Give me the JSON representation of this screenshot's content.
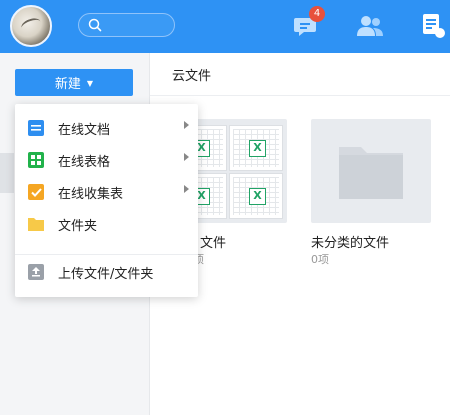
{
  "topbar": {
    "badge_count": "4",
    "accent_color": "#2e92f4",
    "icons": [
      "search-icon",
      "messages-icon",
      "contacts-icon",
      "docs-icon"
    ]
  },
  "sidebar": {
    "new_button_label": "新建"
  },
  "new_menu": {
    "items": [
      {
        "label": "在线文档",
        "icon": "online-doc-icon",
        "color": "#2e8ef0",
        "has_submenu": true
      },
      {
        "label": "在线表格",
        "icon": "online-sheet-icon",
        "color": "#21b24b",
        "has_submenu": true
      },
      {
        "label": "在线收集表",
        "icon": "online-form-icon",
        "color": "#f5a623",
        "has_submenu": true
      },
      {
        "label": "文件夹",
        "icon": "folder-icon",
        "color": "#f7c948",
        "has_submenu": false
      },
      {
        "label": "上传文件/文件夹",
        "icon": "upload-icon",
        "color": "#9aa0a8",
        "has_submenu": false
      }
    ]
  },
  "main": {
    "title": "云文件",
    "tiles": [
      {
        "name": "文件",
        "count": "项"
      },
      {
        "name": "未分类的文件",
        "count": "0项"
      }
    ]
  }
}
